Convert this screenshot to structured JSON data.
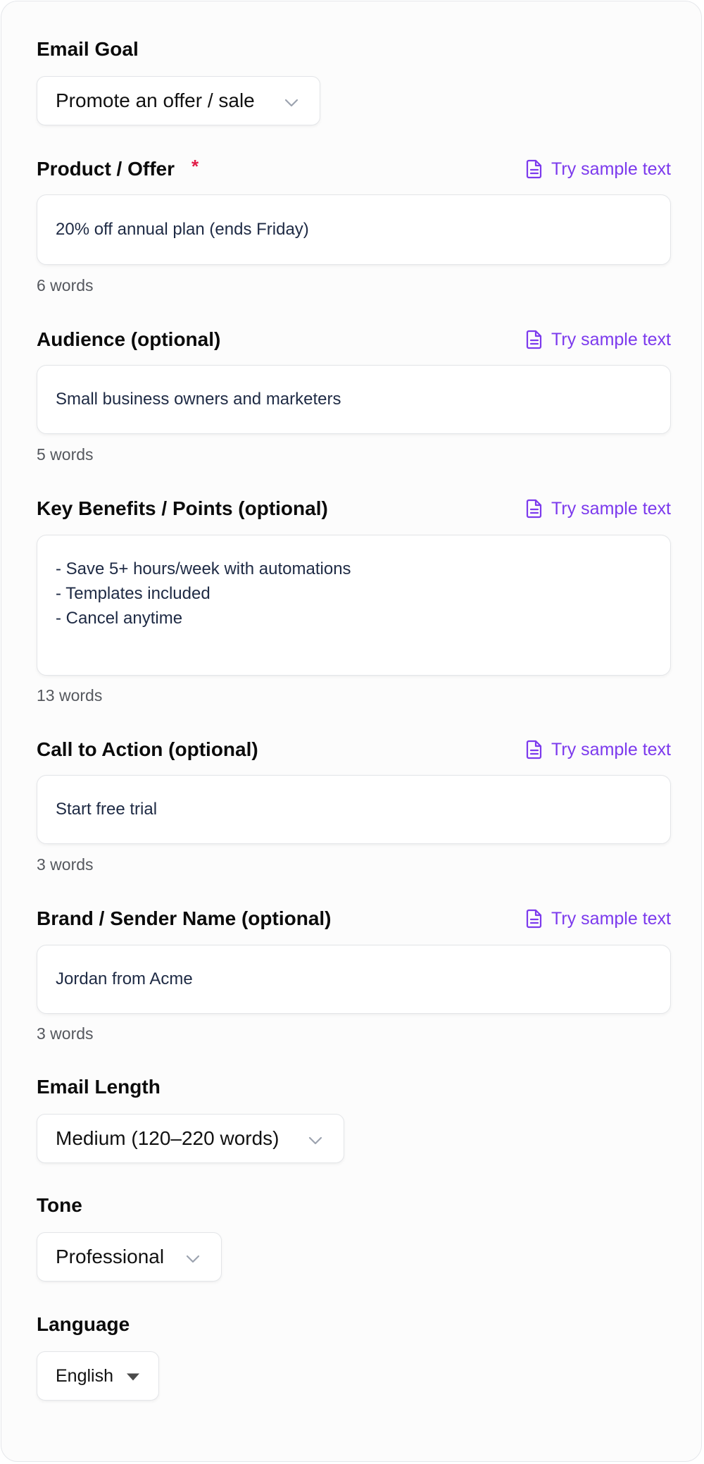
{
  "email_goal": {
    "label": "Email Goal",
    "selected": "Promote an offer / sale"
  },
  "product_offer": {
    "label": "Product / Offer",
    "required_mark": "*",
    "sample_link": "Try sample text",
    "value": "20% off annual plan (ends Friday)",
    "word_count": "6 words"
  },
  "audience": {
    "label": "Audience (optional)",
    "sample_link": "Try sample text",
    "value": "Small business owners and marketers",
    "word_count": "5 words"
  },
  "key_benefits": {
    "label": "Key Benefits / Points (optional)",
    "sample_link": "Try sample text",
    "lines": [
      "- Save 5+ hours/week with automations",
      "- Templates included",
      "- Cancel anytime"
    ],
    "word_count": "13 words"
  },
  "call_to_action": {
    "label": "Call to Action (optional)",
    "sample_link": "Try sample text",
    "value": "Start free trial",
    "word_count": "3 words"
  },
  "brand_sender": {
    "label": "Brand / Sender Name (optional)",
    "sample_link": "Try sample text",
    "value": "Jordan from Acme",
    "word_count": "3 words"
  },
  "email_length": {
    "label": "Email Length",
    "selected": "Medium (120–220 words)"
  },
  "tone": {
    "label": "Tone",
    "selected": "Professional"
  },
  "language": {
    "label": "Language",
    "selected": "English"
  },
  "icons": {
    "sample": "document-icon",
    "dropdown": "chevron-down-icon",
    "native_dropdown": "caret-down-icon"
  },
  "colors": {
    "accent": "#7c3aed",
    "required": "#e11d48",
    "field_text": "#1e2a44",
    "muted": "#55585e"
  }
}
